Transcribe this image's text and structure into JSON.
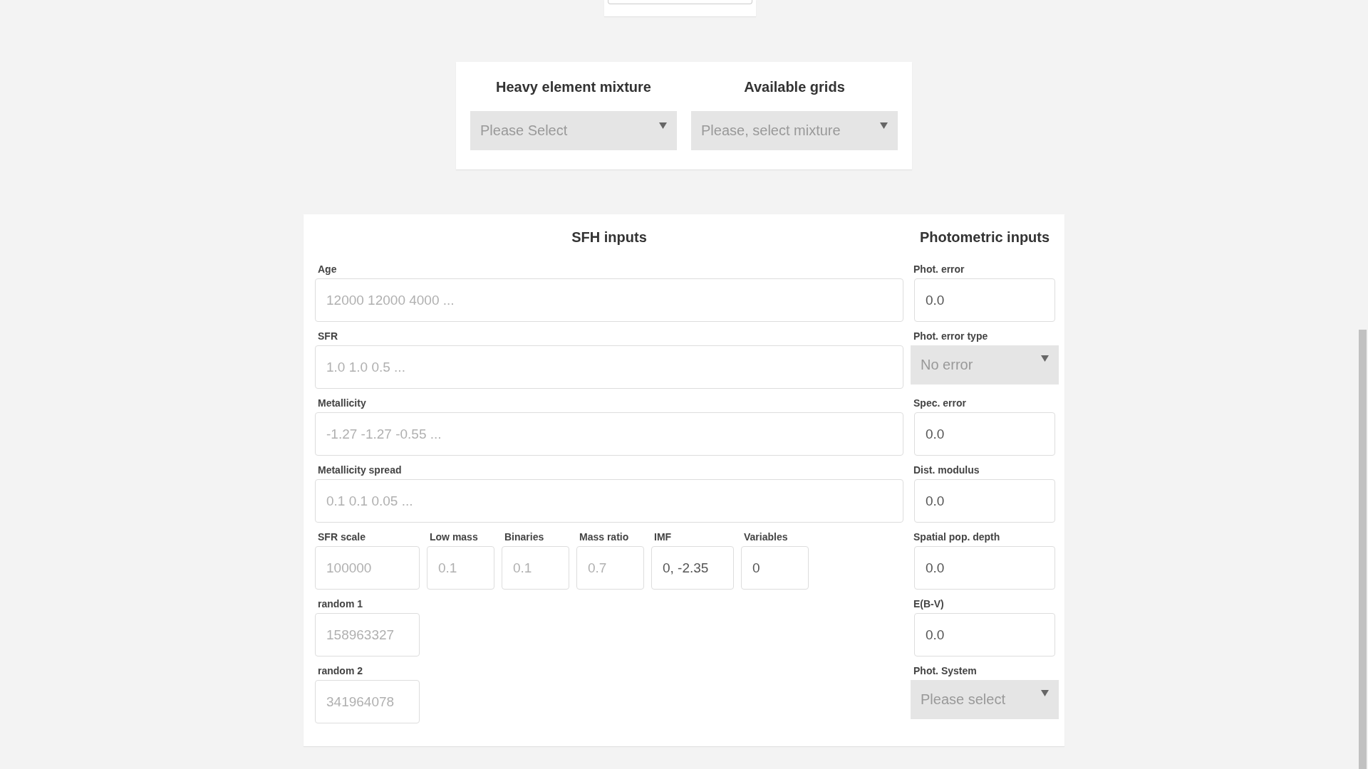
{
  "mixture_panel": {
    "columns": [
      {
        "title": "Heavy element mixture",
        "select": {
          "placeholder": "Please Select"
        }
      },
      {
        "title": "Available grids",
        "select": {
          "placeholder": "Please, select mixture"
        }
      }
    ]
  },
  "sfh_inputs": {
    "title": "SFH inputs",
    "rows": [
      [
        {
          "kind": "wide",
          "label": "Age",
          "placeholder": "12000 12000 4000 ..."
        }
      ],
      [
        {
          "kind": "wide",
          "label": "SFR",
          "placeholder": "1.0 1.0 0.5 ..."
        }
      ],
      [
        {
          "kind": "wide",
          "label": "Metallicity",
          "placeholder": "-1.27 -1.27 -0.55 ..."
        }
      ],
      [
        {
          "kind": "wide",
          "label": "Metallicity spread",
          "placeholder": "0.1 0.1 0.05 ..."
        }
      ],
      [
        {
          "kind": "medium",
          "label": "SFR scale",
          "placeholder": "100000"
        },
        {
          "kind": "small",
          "label": "Low mass",
          "placeholder": "0.1"
        },
        {
          "kind": "small",
          "label": "Binaries",
          "placeholder": "0.1"
        },
        {
          "kind": "small",
          "label": "Mass ratio",
          "placeholder": "0.7"
        },
        {
          "kind": "mid",
          "label": "IMF",
          "value": "0, -2.35"
        },
        {
          "kind": "small",
          "label": "Variables",
          "value": "0"
        }
      ],
      [
        {
          "kind": "medium",
          "label": "random 1",
          "placeholder": "158963327"
        }
      ],
      [
        {
          "kind": "medium",
          "label": "random 2",
          "placeholder": "341964078"
        }
      ]
    ]
  },
  "photometric_inputs": {
    "title": "Photometric inputs",
    "fields": [
      {
        "kind": "input",
        "label": "Phot. error",
        "value": "0.0"
      },
      {
        "kind": "select",
        "label": "Phot. error type",
        "placeholder": "No error"
      },
      {
        "kind": "input",
        "label": "Spec. error",
        "value": "0.0"
      },
      {
        "kind": "input",
        "label": "Dist. modulus",
        "value": "0.0"
      },
      {
        "kind": "input",
        "label": "Spatial pop. depth",
        "value": "0.0"
      },
      {
        "kind": "input",
        "label": "E(B-V)",
        "value": "0.0"
      },
      {
        "kind": "select",
        "label": "Phot. System",
        "placeholder": "Please select"
      }
    ]
  }
}
